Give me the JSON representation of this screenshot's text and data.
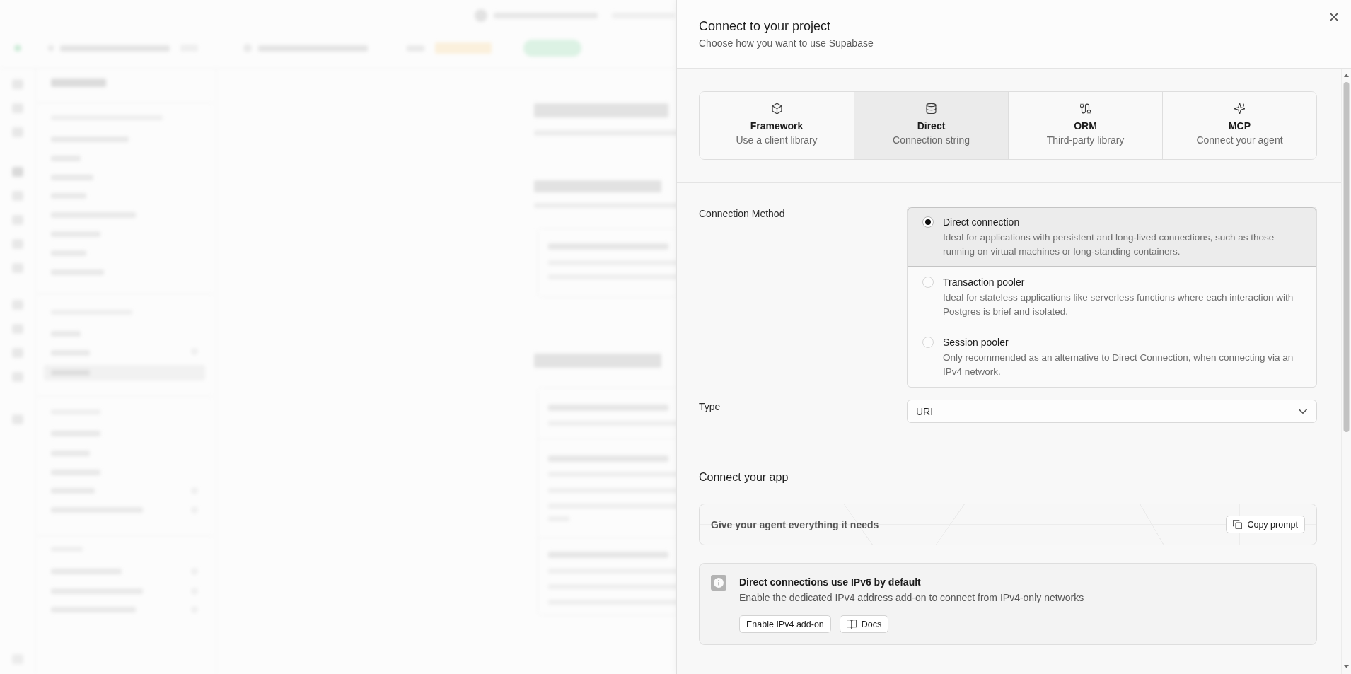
{
  "dialog": {
    "title": "Connect to your project",
    "subtitle": "Choose how you want to use Supabase"
  },
  "modes": [
    {
      "title": "Framework",
      "subtitle": "Use a client library",
      "selected": false
    },
    {
      "title": "Direct",
      "subtitle": "Connection string",
      "selected": true
    },
    {
      "title": "ORM",
      "subtitle": "Third-party library",
      "selected": false
    },
    {
      "title": "MCP",
      "subtitle": "Connect your agent",
      "selected": false
    }
  ],
  "connection_method": {
    "label": "Connection Method",
    "options": [
      {
        "title": "Direct connection",
        "description": "Ideal for applications with persistent and long-lived connections, such as those running on virtual machines or long-standing containers.",
        "selected": true
      },
      {
        "title": "Transaction pooler",
        "description": "Ideal for stateless applications like serverless functions where each interaction with Postgres is brief and isolated.",
        "selected": false
      },
      {
        "title": "Session pooler",
        "description": "Only recommended as an alternative to Direct Connection, when connecting via an IPv4 network.",
        "selected": false
      }
    ]
  },
  "type": {
    "label": "Type",
    "value": "URI"
  },
  "connect_app": {
    "heading": "Connect your app",
    "prompt": {
      "text": "Give your agent everything it needs",
      "button": "Copy prompt"
    },
    "notice": {
      "title": "Direct connections use IPv6 by default",
      "description": "Enable the dedicated IPv4 address add-on to connect from IPv4-only networks",
      "buttons": [
        {
          "kind": "plain",
          "label": "Enable IPv4 add-on"
        },
        {
          "kind": "docs",
          "label": "Docs"
        }
      ]
    }
  }
}
